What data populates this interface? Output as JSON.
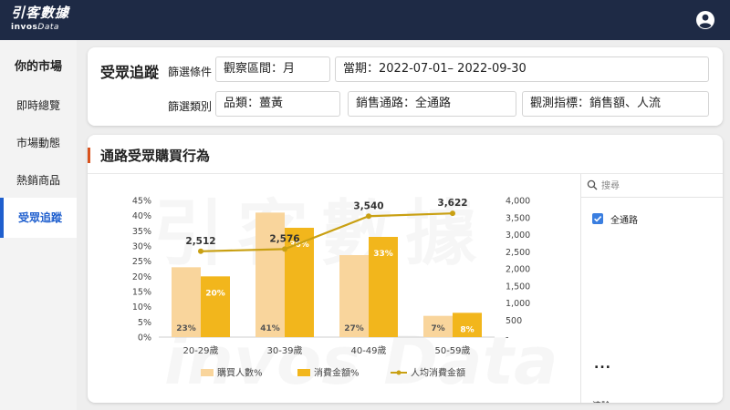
{
  "header": {
    "logo_main": "引客數據",
    "logo_sub_bold": "invos",
    "logo_sub_italic": "Data"
  },
  "sidebar": {
    "title": "你的市場",
    "items": [
      {
        "label": "即時總覽",
        "active": false
      },
      {
        "label": "市場動態",
        "active": false
      },
      {
        "label": "熱銷商品",
        "active": false
      },
      {
        "label": "受眾追蹤",
        "active": true
      }
    ]
  },
  "filters": {
    "page_title": "受眾追蹤",
    "condition_label": "篩選條件",
    "observe_range": "觀察區間：月",
    "period": "當期：2022-07-01– 2022-09-30",
    "category_label": "篩選類別",
    "product": "品類：薑黃",
    "channel": "銷售通路：全通路",
    "metric": "觀測指標：銷售額、人流"
  },
  "section": {
    "title": "通路受眾購買行為",
    "watermark_main": "引客數據",
    "watermark_sub": "invos Data"
  },
  "side_filter": {
    "search_placeholder": "搜尋",
    "options": [
      {
        "label": "全通路",
        "checked": true
      }
    ],
    "more": "...",
    "clear": "清除"
  },
  "colors": {
    "header_bg": "#1e2a45",
    "accent": "#1f5fce",
    "buyers": "#f9d59c",
    "spend": "#f2b61c",
    "avg_line": "#c9a013",
    "section_bar": "#d9531e"
  },
  "chart_data": {
    "type": "bar",
    "categories": [
      "20-29歲",
      "30-39歲",
      "40-49歲",
      "50-59歲"
    ],
    "series": [
      {
        "name": "購買人數%",
        "type": "bar",
        "axis": "left",
        "values": [
          23,
          41,
          27,
          7
        ],
        "labels": [
          "23%",
          "41%",
          "27%",
          "7%"
        ]
      },
      {
        "name": "消費金額%",
        "type": "bar",
        "axis": "left",
        "values": [
          20,
          36,
          33,
          8
        ],
        "labels": [
          "20%",
          "36%",
          "33%",
          "8%"
        ]
      },
      {
        "name": "人均消費金額",
        "type": "line",
        "axis": "right",
        "values": [
          2512,
          2576,
          3540,
          3622
        ],
        "labels": [
          "2,512",
          "2,576",
          "3,540",
          "3,622"
        ]
      }
    ],
    "y_left": {
      "min": 0,
      "max": 45,
      "step": 5,
      "ticks": [
        "0%",
        "5%",
        "10%",
        "15%",
        "20%",
        "25%",
        "30%",
        "35%",
        "40%",
        "45%"
      ]
    },
    "y_right": {
      "min": 0,
      "max": 4000,
      "step": 500,
      "ticks": [
        "-",
        "500",
        "1,000",
        "1,500",
        "2,000",
        "2,500",
        "3,000",
        "3,500",
        "4,000"
      ]
    },
    "legend_position": "bottom",
    "grid": false
  }
}
